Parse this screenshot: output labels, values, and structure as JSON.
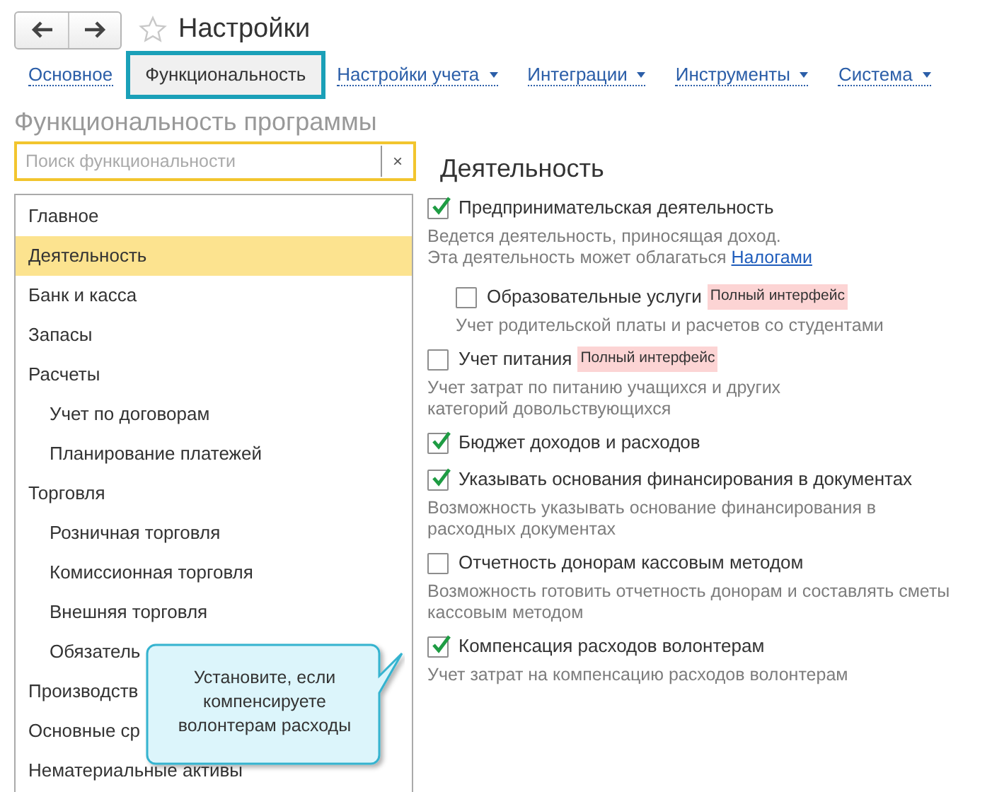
{
  "window": {
    "title": "Настройки"
  },
  "tabs": [
    {
      "label": "Основное",
      "selected": false,
      "has_menu": false
    },
    {
      "label": "Функциональность",
      "selected": true,
      "has_menu": false
    },
    {
      "label": "Настройки учета",
      "selected": false,
      "has_menu": true
    },
    {
      "label": "Интеграции",
      "selected": false,
      "has_menu": true
    },
    {
      "label": "Инструменты",
      "selected": false,
      "has_menu": true
    },
    {
      "label": "Система",
      "selected": false,
      "has_menu": true
    }
  ],
  "section_title": "Функциональность программы",
  "search": {
    "placeholder": "Поиск функциональности",
    "clear": "×"
  },
  "sidebar": {
    "items": [
      {
        "label": "Главное",
        "selected": false
      },
      {
        "label": "Деятельность",
        "selected": true
      },
      {
        "label": "Банк и касса",
        "selected": false
      },
      {
        "label": "Запасы",
        "selected": false
      },
      {
        "label": "Расчеты",
        "selected": false,
        "children": [
          {
            "label": "Учет по договорам",
            "selected": false
          },
          {
            "label": "Планирование платежей",
            "selected": false
          }
        ]
      },
      {
        "label": "Торговля",
        "selected": false,
        "children": [
          {
            "label": "Розничная торговля",
            "selected": false
          },
          {
            "label": "Комиссионная торговля",
            "selected": false
          },
          {
            "label": "Внешняя торговля",
            "selected": false
          },
          {
            "label": "Обязатель",
            "selected": false
          }
        ]
      },
      {
        "label": "Производств",
        "selected": false
      },
      {
        "label": "Основные ср",
        "selected": false
      },
      {
        "label": "Нематериальные активы",
        "selected": false
      }
    ]
  },
  "panel": {
    "title": "Деятельность",
    "options": [
      {
        "label": "Предпринимательская деятельность",
        "checked": true,
        "description": [
          "Ведется деятельность, приносящая доход.",
          "Эта деятельность может облагаться"
        ],
        "link": "Налогами",
        "children": [
          {
            "label": "Образовательные услуги",
            "checked": false,
            "badge": "Полный интерфейс",
            "description": [
              "Учет родительской платы и расчетов со студентами"
            ]
          }
        ]
      },
      {
        "label": "Учет питания",
        "checked": false,
        "badge": "Полный интерфейс",
        "description": [
          "Учет затрат по питанию учащихся и других",
          "категорий довольствующихся"
        ]
      },
      {
        "label": "Бюджет доходов и расходов",
        "checked": true
      },
      {
        "label": "Указывать основания финансирования в документах",
        "checked": true,
        "description": [
          "Возможность указывать основание финансирования в",
          "расходных документах"
        ]
      },
      {
        "label": "Отчетность донорам кассовым методом",
        "checked": false,
        "description": [
          "Возможность готовить отчетность донорам и составлять сметы",
          "кассовым методом"
        ]
      },
      {
        "label": "Компенсация расходов волонтерам",
        "checked": true,
        "description": [
          "Учет затрат на компенсацию расходов волонтерам"
        ]
      }
    ]
  },
  "callout": {
    "lines": [
      "Установите, если",
      "компенсируете",
      "волонтерам расходы"
    ]
  }
}
